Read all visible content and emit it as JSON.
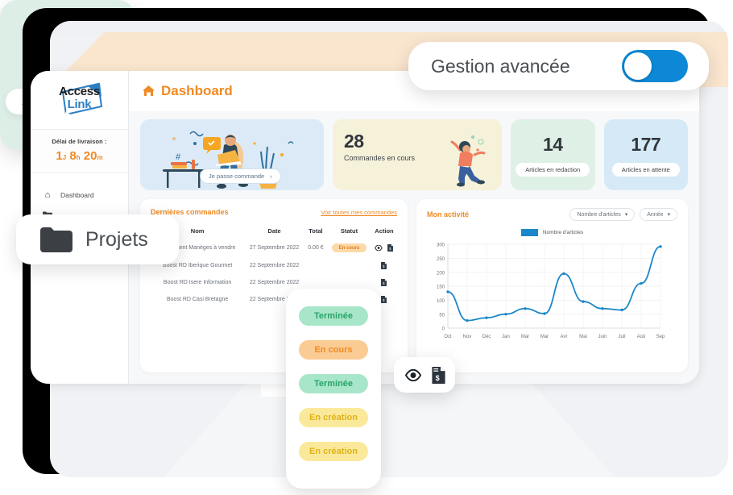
{
  "brand": {
    "name_top": "Access",
    "name_bottom": "Link"
  },
  "sidebar": {
    "delai_label": "Délai de livraison :",
    "timer": {
      "days": "1",
      "days_unit": "J",
      "hours": "8",
      "hours_unit": "h",
      "minutes": "20",
      "minutes_unit": "m"
    },
    "items": [
      {
        "label": "Dashboard",
        "icon": "home-icon"
      },
      {
        "label": "",
        "icon": "folder-icon"
      }
    ]
  },
  "header": {
    "title": "Dashboard",
    "icon": "home-icon"
  },
  "kpis": [
    {
      "id": "illustration",
      "cta": "Je passe commande",
      "cta_icon": "chevron-right-icon"
    },
    {
      "id": "orders",
      "value": "28",
      "label": "Commandes en cours"
    },
    {
      "id": "articles_redaction",
      "value": "14",
      "label": "Articles en redaction"
    },
    {
      "id": "articles_attente",
      "value": "177",
      "label": "Articles en attente"
    }
  ],
  "orders_panel": {
    "title": "Dernières commandes",
    "link": "Voir toutes mes commandes",
    "columns": [
      "Nom",
      "Date",
      "Total",
      "Statut",
      "Action"
    ],
    "rows": [
      {
        "nom": "Lancement Manèges à vendre",
        "date": "27 Septembre 2022",
        "total": "0.00 €",
        "statut": "En cours",
        "statut_type": "encours"
      },
      {
        "nom": "Boost RD Iberique Gourmet",
        "date": "22 Septembre 2022",
        "total": "",
        "statut": "",
        "statut_type": ""
      },
      {
        "nom": "Boost RD Isere Information",
        "date": "22 Septembre 2022",
        "total": "",
        "statut": "",
        "statut_type": ""
      },
      {
        "nom": "Boost RD Casi Bretagne",
        "date": "22 Septembre 2022",
        "total": "",
        "statut": "",
        "statut_type": ""
      }
    ]
  },
  "chart_panel": {
    "title": "Mon activité",
    "control_metric": "Nombre d'articles",
    "control_period": "Année"
  },
  "chart_data": {
    "type": "line",
    "title": "Mon activité",
    "xlabel": "",
    "ylabel": "",
    "legend": [
      "Nombre d'articles"
    ],
    "legend_position": "top-center",
    "grid": true,
    "color": "#1b87c9",
    "categories": [
      "Oct",
      "Nov",
      "Déc",
      "Jan",
      "Mar",
      "Mar",
      "Avr",
      "Mai",
      "Juin",
      "Juil",
      "Aoû",
      "Sep"
    ],
    "series": [
      {
        "name": "Nombre d'articles",
        "values": [
          130,
          27,
          37,
          50,
          70,
          52,
          195,
          95,
          70,
          65,
          160,
          292
        ]
      }
    ],
    "ylim": [
      0,
      300
    ],
    "yticks": [
      0,
      50,
      100,
      150,
      200,
      250,
      300
    ]
  },
  "overlays": {
    "articles_card": {
      "value": "14",
      "label": "Articles en redaction"
    },
    "toggle_card": {
      "label": "Gestion avancée",
      "state": "on"
    },
    "projets_card": {
      "label": "Projets",
      "icon": "folder-icon"
    },
    "status_card": {
      "badges": [
        {
          "label": "Terminée",
          "type": "green"
        },
        {
          "label": "En cours",
          "type": "orange"
        },
        {
          "label": "Terminée",
          "type": "green"
        },
        {
          "label": "En création",
          "type": "yellow"
        },
        {
          "label": "En création",
          "type": "yellow"
        }
      ]
    },
    "actions_card": {
      "icons": [
        "eye-icon",
        "invoice-icon"
      ]
    }
  },
  "colors": {
    "accent_orange": "#f08a24",
    "accent_blue": "#1b87c9",
    "toggle_blue": "#0d88d6",
    "green_badge": "#a8e6c9",
    "orange_badge": "#fbcb94",
    "yellow_badge": "#fbe99b"
  }
}
